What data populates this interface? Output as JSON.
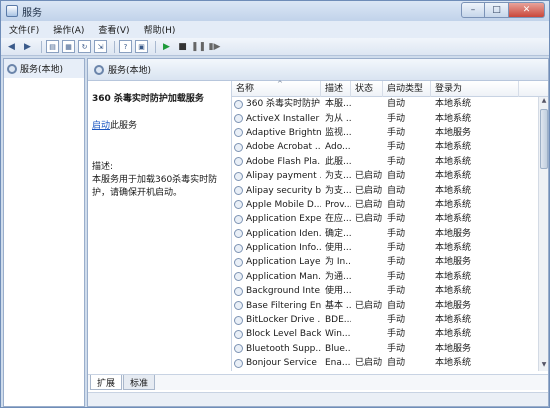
{
  "window": {
    "title": "服务",
    "minimize": "–",
    "maximize": "□",
    "close": "✕"
  },
  "menu": [
    "文件(F)",
    "操作(A)",
    "查看(V)",
    "帮助(H)"
  ],
  "tree": {
    "root": "服务(本地)"
  },
  "panel": {
    "header": "服务(本地)"
  },
  "desc": {
    "service_name": "360 杀毒实时防护加载服务",
    "start_link": "启动",
    "start_suffix": "此服务",
    "label": "描述:",
    "text": "本服务用于加载360杀毒实时防护，请确保开机启动。"
  },
  "columns": [
    "名称",
    "描述",
    "状态",
    "启动类型",
    "登录为"
  ],
  "rows": [
    {
      "name": "360 杀毒实时防护...",
      "desc": "本服...",
      "status": "",
      "startup": "自动",
      "logon": "本地系统"
    },
    {
      "name": "ActiveX Installer ...",
      "desc": "为从 ...",
      "status": "",
      "startup": "手动",
      "logon": "本地系统"
    },
    {
      "name": "Adaptive Brightn...",
      "desc": "监视...",
      "status": "",
      "startup": "手动",
      "logon": "本地服务"
    },
    {
      "name": "Adobe Acrobat ...",
      "desc": "Ado...",
      "status": "",
      "startup": "手动",
      "logon": "本地系统"
    },
    {
      "name": "Adobe Flash Pla...",
      "desc": "此服...",
      "status": "",
      "startup": "手动",
      "logon": "本地系统"
    },
    {
      "name": "Alipay payment ...",
      "desc": "为支...",
      "status": "已启动",
      "startup": "自动",
      "logon": "本地系统"
    },
    {
      "name": "Alipay security b...",
      "desc": "为支...",
      "status": "已启动",
      "startup": "自动",
      "logon": "本地系统"
    },
    {
      "name": "Apple Mobile D...",
      "desc": "Prov...",
      "status": "已启动",
      "startup": "自动",
      "logon": "本地系统"
    },
    {
      "name": "Application Expe...",
      "desc": "在应...",
      "status": "已启动",
      "startup": "手动",
      "logon": "本地系统"
    },
    {
      "name": "Application Iden...",
      "desc": "确定...",
      "status": "",
      "startup": "手动",
      "logon": "本地服务"
    },
    {
      "name": "Application Info...",
      "desc": "使用...",
      "status": "",
      "startup": "手动",
      "logon": "本地系统"
    },
    {
      "name": "Application Laye...",
      "desc": "为 In...",
      "status": "",
      "startup": "手动",
      "logon": "本地服务"
    },
    {
      "name": "Application Man...",
      "desc": "为通...",
      "status": "",
      "startup": "手动",
      "logon": "本地系统"
    },
    {
      "name": "Background Inte...",
      "desc": "使用...",
      "status": "",
      "startup": "手动",
      "logon": "本地系统"
    },
    {
      "name": "Base Filtering En...",
      "desc": "基本 ...",
      "status": "已启动",
      "startup": "自动",
      "logon": "本地服务"
    },
    {
      "name": "BitLocker Drive ...",
      "desc": "BDE...",
      "status": "",
      "startup": "手动",
      "logon": "本地系统"
    },
    {
      "name": "Block Level Back...",
      "desc": "Win...",
      "status": "",
      "startup": "手动",
      "logon": "本地系统"
    },
    {
      "name": "Bluetooth Supp...",
      "desc": "Blue...",
      "status": "",
      "startup": "手动",
      "logon": "本地服务"
    },
    {
      "name": "Bonjour Service",
      "desc": "Ena...",
      "status": "已启动",
      "startup": "自动",
      "logon": "本地系统"
    }
  ],
  "tabs": [
    "扩展",
    "标准"
  ]
}
